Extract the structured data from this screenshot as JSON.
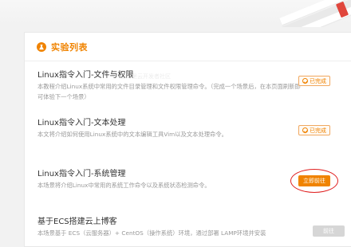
{
  "header": {
    "title": "实验列表"
  },
  "watermark": "@阿里云开发者社区",
  "experiments": [
    {
      "title": "Linux指令入门-文件与权限",
      "desc": "本教程介绍Linux系统中常用的文件目录管理和文件权限管理命令。（完成一个场景后，在本页面刷新即可体验下一个场景）",
      "status": "已完成"
    },
    {
      "title": "Linux指令入门-文本处理",
      "desc": "本文将介绍如何使用Linux系统中的文本编辑工具Vim以及文本处理命令。",
      "status": "已完成"
    },
    {
      "title": "Linux指令入门-系统管理",
      "desc": "本场景将介绍Linux中常用的系统工作命令以及系统状态检测命令。",
      "action": "立即前往"
    },
    {
      "title": "基于ECS搭建云上博客",
      "desc": "本场景基于 ECS（云服务器）+ CentOS（操作系统）环境，通过部署 LAMP环境并安装",
      "action": "前往"
    }
  ],
  "colors": {
    "accent": "#f08300",
    "highlight_ring": "#e02020"
  }
}
